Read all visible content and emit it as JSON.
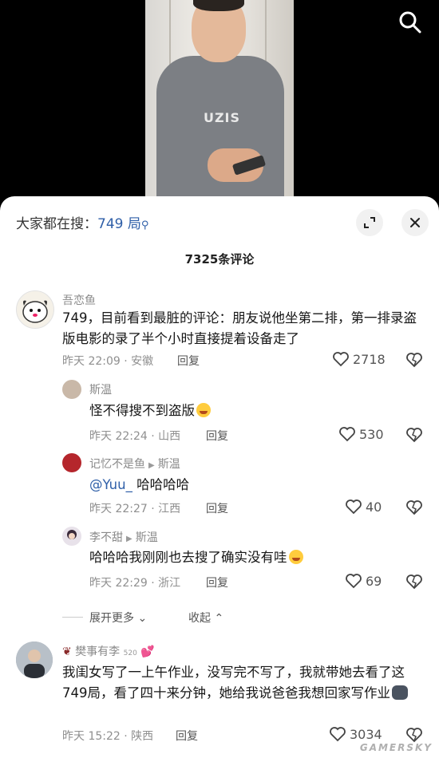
{
  "header": {
    "search_hint_label": "大家都在搜：",
    "search_keyword": "749 局",
    "comment_count": "7325条评论"
  },
  "comments": [
    {
      "user": "吾恋鱼",
      "text": "749，目前看到最脏的评论：朋友说他坐第二排，第一排录盗版电影的录了半个小时直接提着设备走了",
      "time": "昨天 22:09 · 安徽",
      "reply": "回复",
      "likes": "2718"
    },
    {
      "user": "斯温",
      "text": "怪不得搜不到盗版",
      "time": "昨天 22:24 · 山西",
      "reply": "回复",
      "likes": "530"
    },
    {
      "user": "记忆不是鱼",
      "reply_to": "斯温",
      "mention": "@Yuu_",
      "text": " 哈哈哈哈",
      "time": "昨天 22:27 · 江西",
      "reply": "回复",
      "likes": "40"
    },
    {
      "user": "李不甜",
      "reply_to": "斯温",
      "text": "哈哈哈我刚刚也去搜了确实没有哇",
      "time": "昨天 22:29 · 浙江",
      "reply": "回复",
      "likes": "69"
    },
    {
      "user": "樊事有李",
      "badge": "520",
      "text": "我闺女写了一上午作业，没写完不写了，我就带她去看了这749局，看了四十来分钟，她给我说爸爸我想回家写作业",
      "time": "昨天 15:22 · 陕西",
      "reply": "回复",
      "likes": "3034"
    }
  ],
  "thread_controls": {
    "expand_more": "展开更多",
    "collapse": "收起"
  },
  "video": {
    "shirt_text": "UZIS"
  },
  "watermark": "GAMERSKY",
  "colors": {
    "link": "#2f5fa8",
    "sheet_bg": "#ffffff",
    "meta_gray": "#8f8f8f"
  }
}
